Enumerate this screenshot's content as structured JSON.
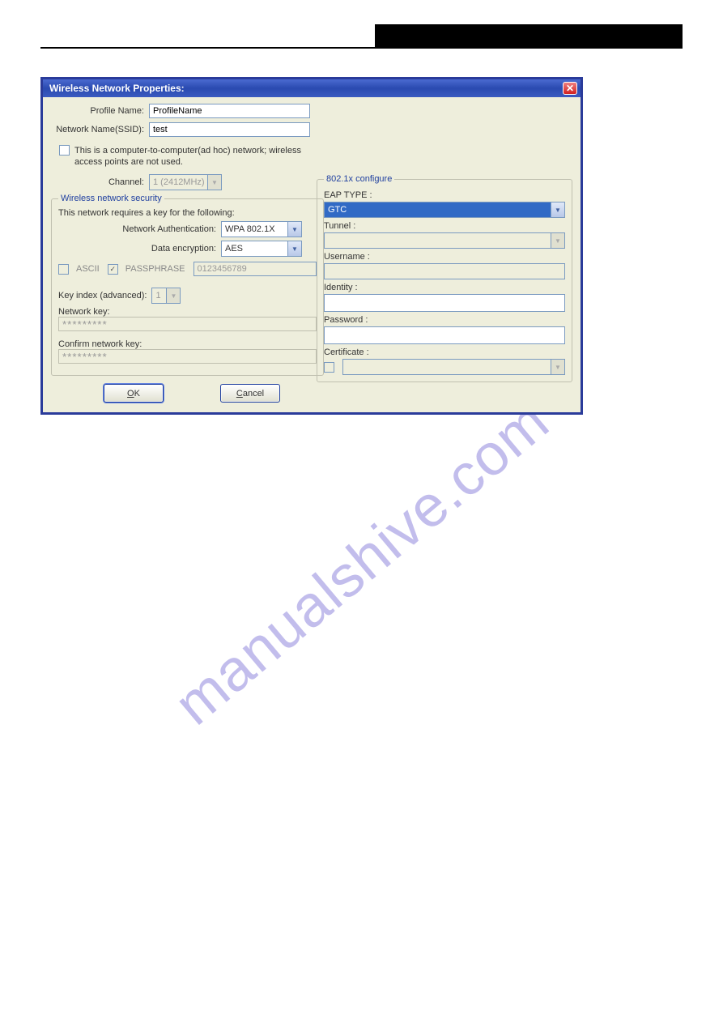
{
  "watermark": "manualshive.com",
  "dialog": {
    "title": "Wireless Network Properties:",
    "profile_name_label": "Profile Name:",
    "profile_name_value": "ProfileName",
    "ssid_label": "Network Name(SSID):",
    "ssid_value": "test",
    "adhoc_text": "This is a computer-to-computer(ad hoc) network; wireless access points are not used.",
    "channel_label": "Channel:",
    "channel_value": "1  (2412MHz)",
    "security": {
      "legend": "Wireless network security",
      "intro": "This network requires a key for the following:",
      "auth_label": "Network Authentication:",
      "auth_value": "WPA 802.1X",
      "enc_label": "Data encryption:",
      "enc_value": "AES",
      "ascii_label": "ASCII",
      "passphrase_label": "PASSPHRASE",
      "passphrase_value": "0123456789",
      "keyindex_label": "Key index (advanced):",
      "keyindex_value": "1",
      "netkey_label": "Network key:",
      "netkey_value": "*********",
      "confirm_label": "Confirm network key:",
      "confirm_value": "*********"
    },
    "dot1x": {
      "legend": "802.1x configure",
      "eap_label": "EAP TYPE :",
      "eap_value": "GTC",
      "tunnel_label": "Tunnel :",
      "username_label": "Username :",
      "identity_label": "Identity :",
      "password_label": "Password :",
      "cert_label": "Certificate :"
    },
    "ok_label": "OK",
    "cancel_label": "Cancel"
  }
}
